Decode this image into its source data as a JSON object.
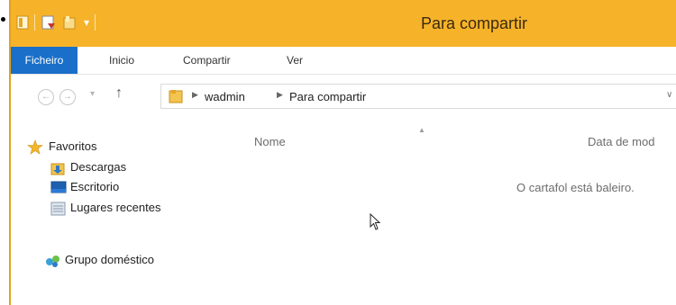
{
  "window": {
    "title": "Para compartir",
    "accent_color": "#f6b32a",
    "file_tab_color": "#1a6fc9"
  },
  "quick_access": {
    "icons": [
      "folder-icon",
      "properties-icon",
      "new-folder-icon",
      "customize-arrow-icon"
    ]
  },
  "ribbon": {
    "tabs": [
      {
        "label": "Ficheiro",
        "active": true
      },
      {
        "label": "Inicio"
      },
      {
        "label": "Compartir"
      },
      {
        "label": "Ver"
      }
    ]
  },
  "address": {
    "crumbs": [
      "wadmin",
      "Para compartir"
    ]
  },
  "nav": {
    "favorites": "Favoritos",
    "favorite_items": [
      "Descargas",
      "Escritorio",
      "Lugares recentes"
    ],
    "homegroup": "Grupo doméstico"
  },
  "content": {
    "columns": [
      "Nome",
      "Data de mod"
    ],
    "empty_message": "O cartafol está baleiro."
  }
}
